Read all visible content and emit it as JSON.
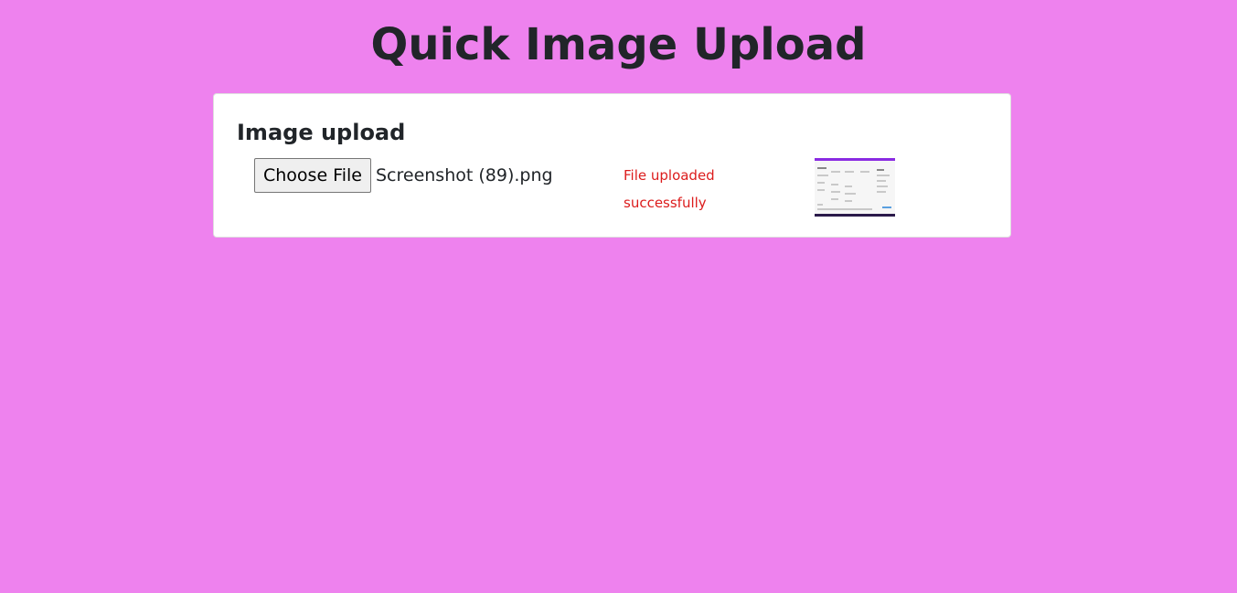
{
  "page": {
    "title": "Quick Image Upload",
    "background_color": "#ee82ee"
  },
  "card": {
    "title": "Image upload",
    "file_input": {
      "button_label": "Choose File",
      "file_name": "Screenshot (89).png"
    },
    "status_message": "File uploaded successfully",
    "status_color": "#dc1c1c",
    "preview": {
      "icon": "image-preview-thumbnail"
    }
  }
}
